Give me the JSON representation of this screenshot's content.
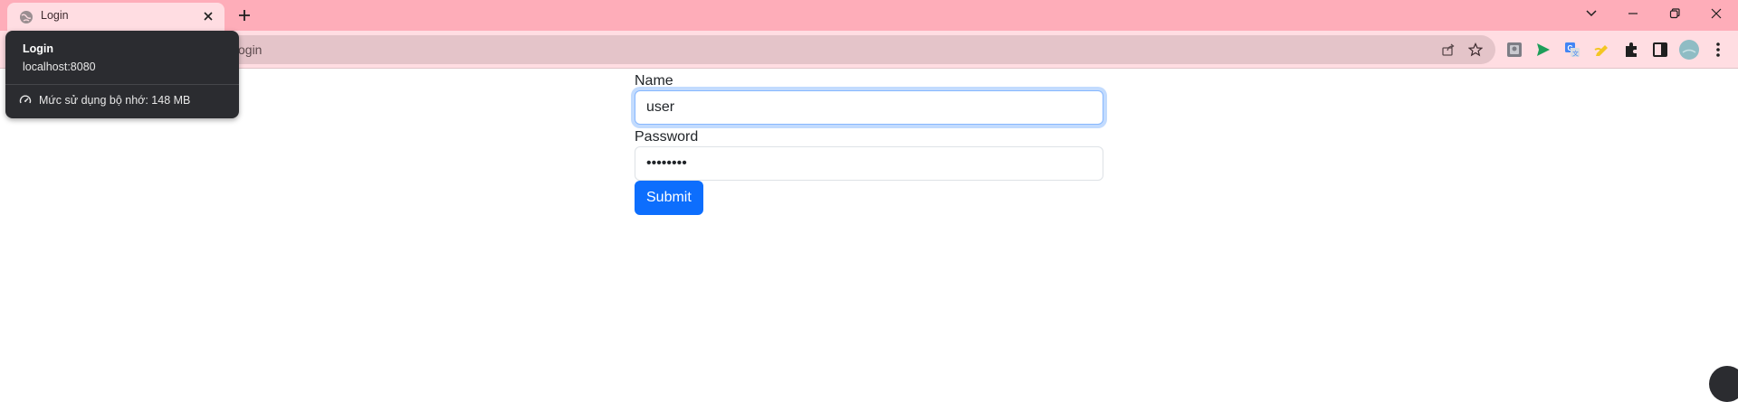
{
  "browser": {
    "tab": {
      "title": "Login"
    },
    "new_tab_symbol": "+",
    "omnibox": {
      "url_visible": "/login"
    },
    "hover_card": {
      "title": "Login",
      "host": "localhost:8080",
      "memory_text": "Mức sử dụng bộ nhớ: 148 MB"
    },
    "icons": [
      "globe-icon",
      "close-icon",
      "plus-icon",
      "chevron-down-icon",
      "minimize-icon",
      "restore-icon",
      "window-close-icon",
      "share-icon",
      "star-icon",
      "extension-icon",
      "send-icon",
      "translate-icon",
      "pencil-icon",
      "puzzle-icon",
      "side-panel-icon",
      "profile-avatar",
      "menu-kebab-icon",
      "memory-gauge-icon"
    ]
  },
  "form": {
    "name_label": "Name",
    "name_value": "user",
    "password_label": "Password",
    "password_value": "••••••••",
    "submit_label": "Submit"
  },
  "colors": {
    "tabstrip": "#feadb9",
    "toolbar": "#ffdde2",
    "primary": "#0d6efd"
  }
}
